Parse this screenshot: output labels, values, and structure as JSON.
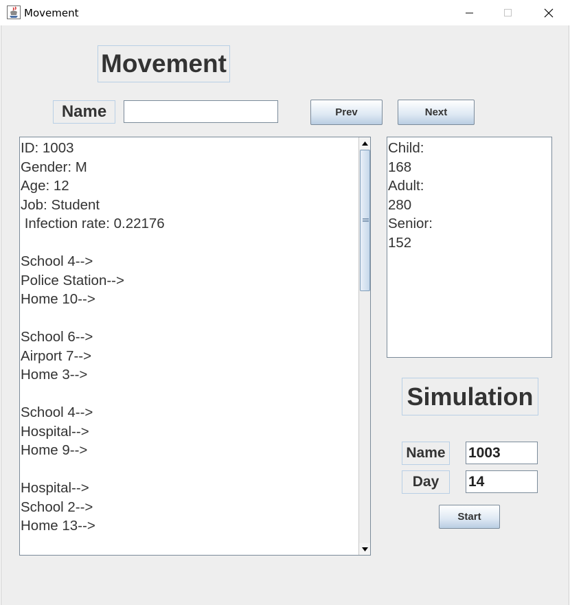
{
  "window": {
    "title": "Movement",
    "app_icon": "java-cup-icon",
    "controls": [
      "minimize-icon",
      "maximize-icon",
      "close-icon"
    ]
  },
  "movement": {
    "heading": "Movement",
    "name_label": "Name",
    "name_value": "",
    "prev_label": "Prev",
    "next_label": "Next",
    "details": [
      "ID: 1003",
      "Gender: M",
      "Age: 12",
      "Job: Student",
      " Infection rate: 0.22176",
      "",
      "School 4-->",
      "Police Station-->",
      "Home 10-->",
      "",
      "School 6-->",
      "Airport 7-->",
      "Home 3-->",
      "",
      "School 4-->",
      "Hospital-->",
      "Home 9-->",
      "",
      "Hospital-->",
      "School 2-->",
      "Home 13-->"
    ]
  },
  "stats": {
    "lines": [
      "Child:",
      "168",
      "Adult:",
      "280",
      "Senior:",
      "152"
    ]
  },
  "simulation": {
    "heading": "Simulation",
    "name_label": "Name",
    "name_value": "1003",
    "day_label": "Day",
    "day_value": "14",
    "start_label": "Start"
  },
  "colors": {
    "background": "#eeeeee",
    "label_border": "#b8cfe5",
    "button_gradient_end": "#b9cde2"
  }
}
